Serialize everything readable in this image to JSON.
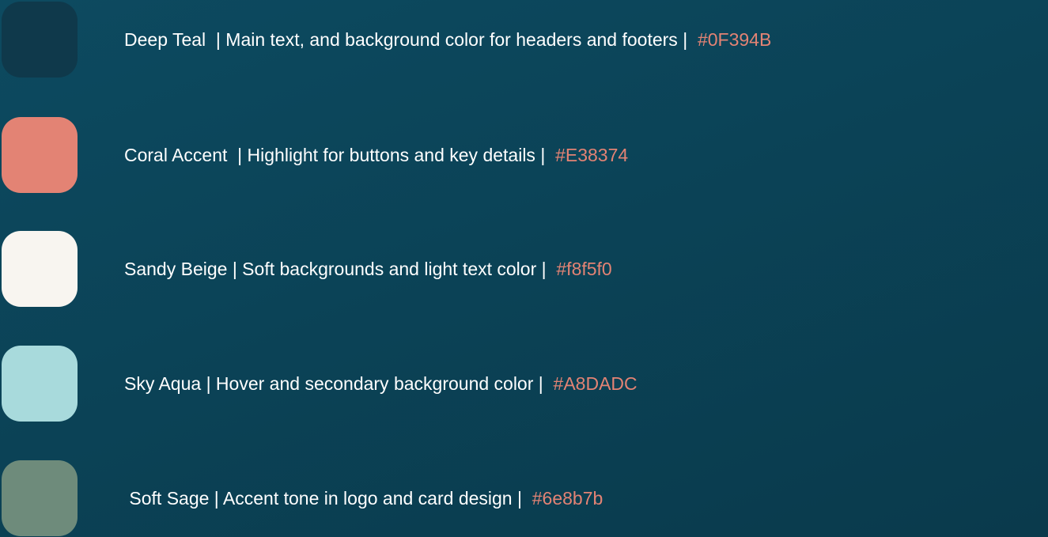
{
  "colors": [
    {
      "description": "Deep Teal  | Main text, and background color for headers and footers |  ",
      "hex": "#0F394B",
      "swatch_color": "#0F394B"
    },
    {
      "description": "Coral Accent  | Highlight for buttons and key details |  ",
      "hex": "#E38374",
      "swatch_color": "#E38374"
    },
    {
      "description": "Sandy Beige | Soft backgrounds and light text color |  ",
      "hex": "#f8f5f0",
      "swatch_color": "#f8f5f0"
    },
    {
      "description": "Sky Aqua | Hover and secondary background color |  ",
      "hex": "#A8DADC",
      "swatch_color": "#A8DADC"
    },
    {
      "description": " Soft Sage | Accent tone in logo and card design |  ",
      "hex": "#6e8b7b",
      "swatch_color": "#6e8b7b"
    }
  ],
  "hex_text_color": "#e38374"
}
